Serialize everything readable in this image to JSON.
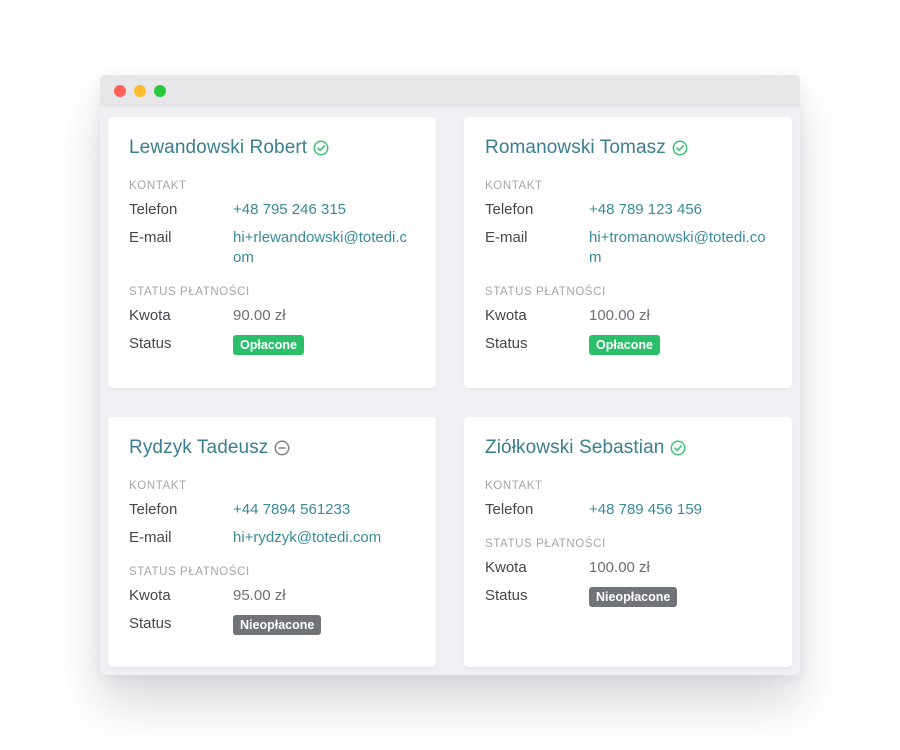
{
  "colors": {
    "accent": "#3a7f90",
    "paid": "#2cbf6b",
    "unpaid": "#707378",
    "verified_icon": "#3ec27a",
    "pending_icon": "#7f848b"
  },
  "labels": {
    "contact_section": "KONTAKT",
    "payment_section": "STATUS PŁATNOŚCI",
    "phone": "Telefon",
    "email": "E-mail",
    "amount": "Kwota",
    "status": "Status"
  },
  "customers": [
    {
      "name": "Lewandowski Robert",
      "verification_icon": "check-circle-icon",
      "phone": "+48 795 246 315",
      "email": "hi+rlewandowski@totedi.com",
      "amount": "90.00 zł",
      "payment_status": "Opłacone",
      "paid": true
    },
    {
      "name": "Romanowski Tomasz",
      "verification_icon": "check-circle-icon",
      "phone": "+48 789 123 456",
      "email": "hi+tromanowski@totedi.com",
      "amount": "100.00 zł",
      "payment_status": "Opłacone",
      "paid": true
    },
    {
      "name": "Rydzyk Tadeusz",
      "verification_icon": "minus-circle-icon",
      "phone": "+44 7894 561233",
      "email": "hi+rydzyk@totedi.com",
      "amount": "95.00 zł",
      "payment_status": "Nieopłacone",
      "paid": false
    },
    {
      "name": "Ziółkowski Sebastian",
      "verification_icon": "check-circle-icon",
      "phone": "+48 789 456 159",
      "email": null,
      "amount": "100.00 zł",
      "payment_status": "Nieopłacone",
      "paid": false
    }
  ]
}
